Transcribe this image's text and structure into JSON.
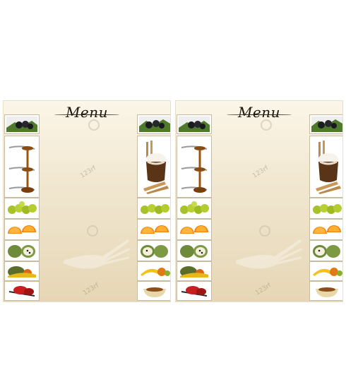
{
  "panels": [
    {
      "title": "Menu"
    },
    {
      "title": "Menu"
    }
  ],
  "watermark": "123rf",
  "tiles": [
    {
      "icon": "blackberries-icon"
    },
    {
      "icon": "honey-spoon-icon"
    },
    {
      "icon": "grapes-icon"
    },
    {
      "icon": "orange-slices-icon"
    },
    {
      "icon": "cherimoya-icon"
    },
    {
      "icon": "mixed-fruit-icon"
    },
    {
      "icon": "red-pepper-icon"
    }
  ],
  "tiles_right": [
    {
      "icon": "blackberries-icon"
    },
    {
      "icon": "coffee-cream-icon"
    },
    {
      "icon": "grapes-icon"
    },
    {
      "icon": "orange-slices-icon"
    },
    {
      "icon": "cherimoya-icon"
    },
    {
      "icon": "banana-fruit-icon"
    },
    {
      "icon": "pudding-bowl-icon"
    }
  ]
}
